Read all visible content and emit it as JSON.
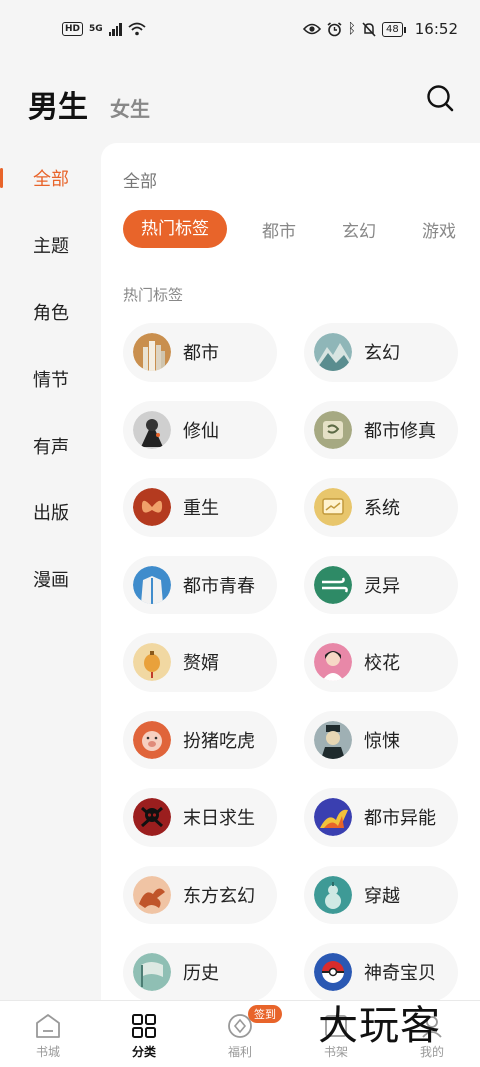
{
  "status_bar": {
    "hd": "HD",
    "network": "5G",
    "battery": "48",
    "time": "16:52"
  },
  "header": {
    "tab_male": "男生",
    "tab_female": "女生"
  },
  "sidebar": {
    "items": [
      {
        "label": "全部",
        "active": true
      },
      {
        "label": "主题"
      },
      {
        "label": "角色"
      },
      {
        "label": "情节"
      },
      {
        "label": "有声"
      },
      {
        "label": "出版"
      },
      {
        "label": "漫画"
      }
    ]
  },
  "panel": {
    "title": "全部",
    "chips": [
      {
        "label": "热门标签",
        "active": true
      },
      {
        "label": "都市"
      },
      {
        "label": "玄幻"
      },
      {
        "label": "游戏"
      }
    ],
    "section_label": "热门标签",
    "tags": [
      {
        "label": "都市",
        "icon": "city-icon"
      },
      {
        "label": "玄幻",
        "icon": "mountain-icon"
      },
      {
        "label": "修仙",
        "icon": "cultivator-icon"
      },
      {
        "label": "都市修真",
        "icon": "scroll-icon"
      },
      {
        "label": "重生",
        "icon": "butterfly-icon"
      },
      {
        "label": "系统",
        "icon": "screen-icon"
      },
      {
        "label": "都市青春",
        "icon": "jacket-icon"
      },
      {
        "label": "灵异",
        "icon": "wind-icon"
      },
      {
        "label": "赘婿",
        "icon": "lantern-icon"
      },
      {
        "label": "校花",
        "icon": "girl-icon"
      },
      {
        "label": "扮猪吃虎",
        "icon": "pig-icon"
      },
      {
        "label": "惊悚",
        "icon": "zombie-icon"
      },
      {
        "label": "末日求生",
        "icon": "skull-icon"
      },
      {
        "label": "都市异能",
        "icon": "lightning-icon"
      },
      {
        "label": "东方玄幻",
        "icon": "dragon-icon"
      },
      {
        "label": "穿越",
        "icon": "gourd-icon"
      },
      {
        "label": "历史",
        "icon": "flag-icon"
      },
      {
        "label": "神奇宝贝",
        "icon": "pokeball-icon"
      }
    ]
  },
  "bottom_nav": {
    "items": [
      {
        "label": "书城"
      },
      {
        "label": "分类",
        "active": true
      },
      {
        "label": "福利",
        "badge": "签到"
      },
      {
        "label": "书架"
      },
      {
        "label": "我的"
      }
    ]
  },
  "watermark": "大玩客",
  "colors": {
    "accent": "#e8642a"
  }
}
